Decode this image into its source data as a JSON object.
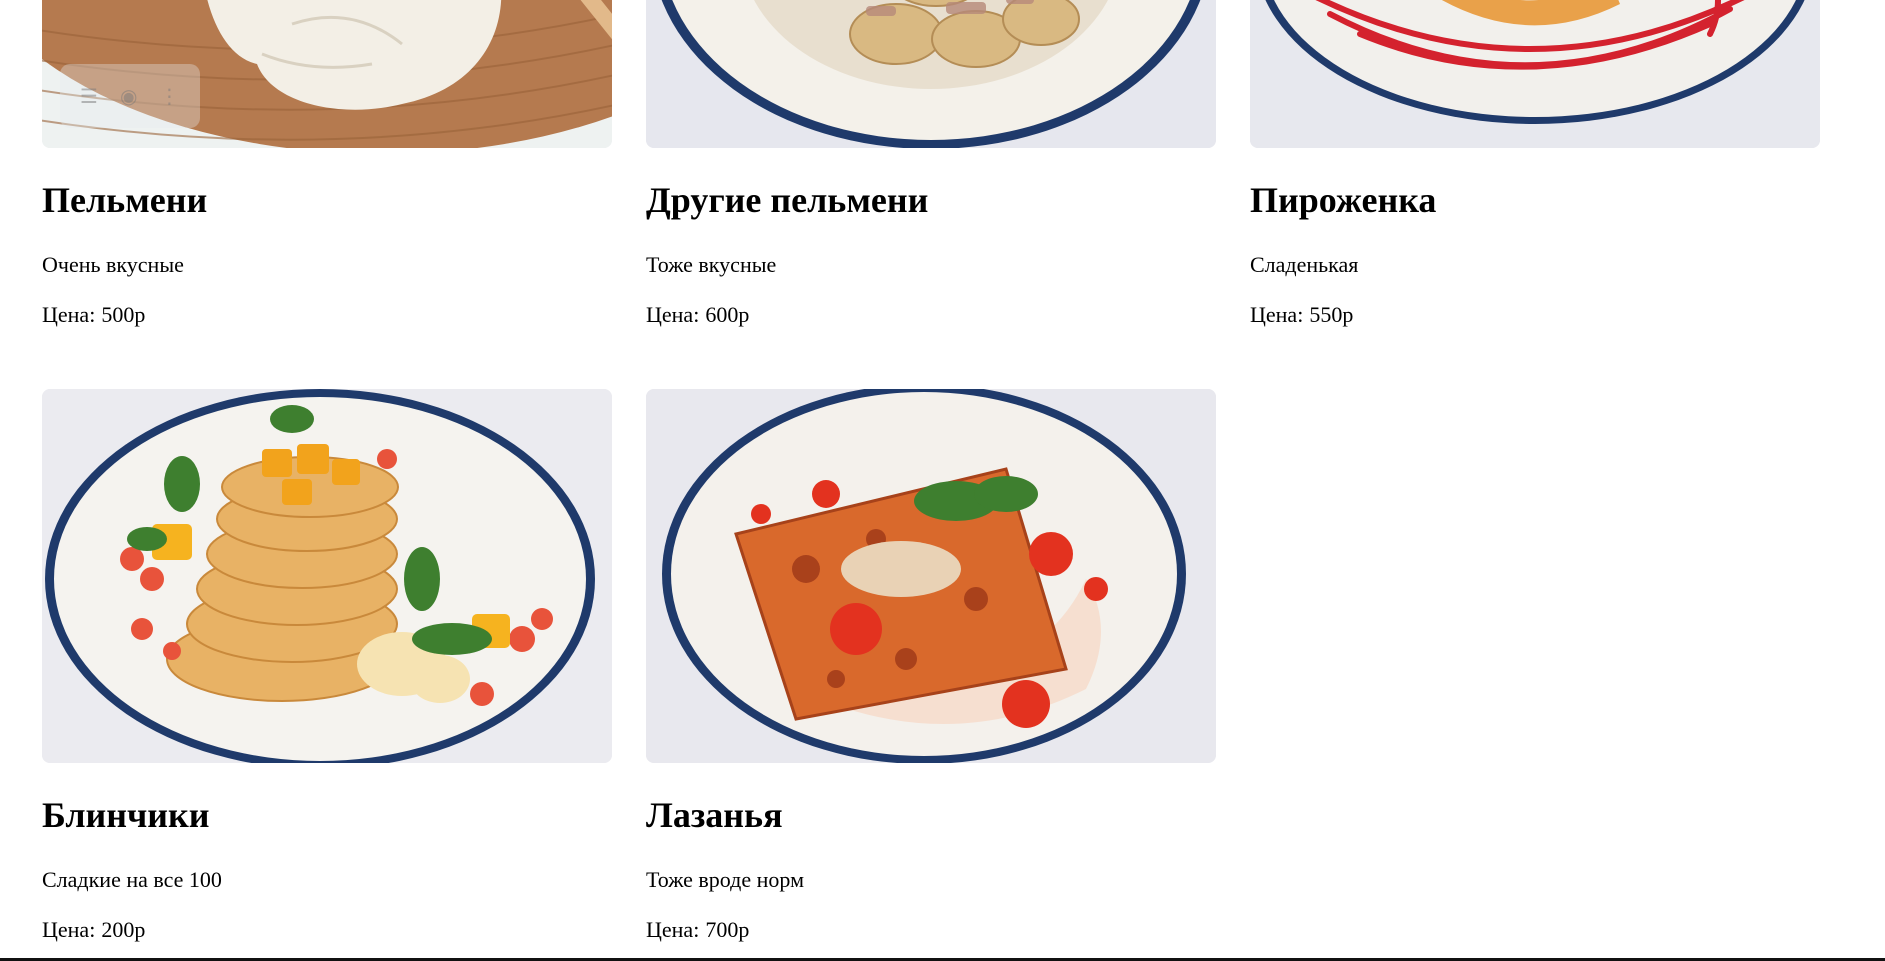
{
  "menu": {
    "price_prefix": "Цена:",
    "items": [
      {
        "title": "Пельмени",
        "description": "Очень вкусные",
        "price": "500р",
        "image": "burrata-board-photo"
      },
      {
        "title": "Другие пельмени",
        "description": "Тоже вкусные",
        "price": "600р",
        "image": "dumplings-plate-photo"
      },
      {
        "title": "Пироженка",
        "description": "Сладенькая",
        "price": "550р",
        "image": "dessert-plate-photo"
      },
      {
        "title": "Блинчики",
        "description": "Сладкие на все 100",
        "price": "200р",
        "image": "pancakes-plate-photo"
      },
      {
        "title": "Лазанья",
        "description": "Тоже вроде норм",
        "price": "700р",
        "image": "lasagna-plate-photo"
      }
    ]
  },
  "image_toolbar": {
    "icons": [
      "bookmark-icon",
      "camera-icon",
      "more-icon"
    ]
  },
  "colors": {
    "background": "#ffffff",
    "plate_rim": "#1f3a6b",
    "text": "#000000"
  }
}
